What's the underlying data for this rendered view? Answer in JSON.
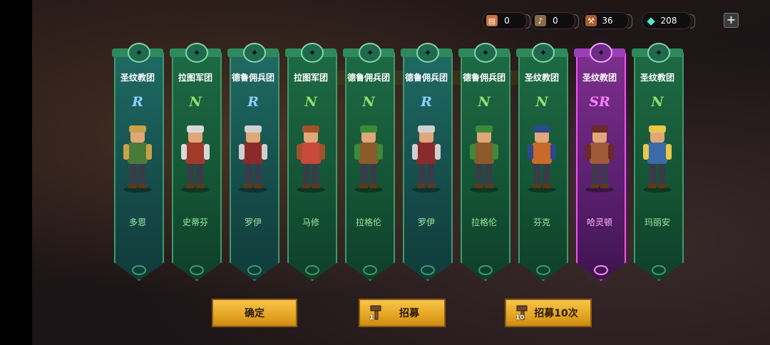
{
  "resources": [
    {
      "icon": "scroll-icon",
      "value": "0"
    },
    {
      "icon": "horn-icon",
      "value": "0"
    },
    {
      "icon": "hammer-icon",
      "value": "36"
    },
    {
      "icon": "diamond-icon",
      "value": "208"
    }
  ],
  "add_button_label": "+",
  "cards": [
    {
      "faction": "圣纹教团",
      "rarity": "R",
      "name": "多恩"
    },
    {
      "faction": "拉图军团",
      "rarity": "N",
      "name": "史蒂芬"
    },
    {
      "faction": "德鲁佣兵团",
      "rarity": "R",
      "name": "罗伊"
    },
    {
      "faction": "拉图军团",
      "rarity": "N",
      "name": "马修"
    },
    {
      "faction": "德鲁佣兵团",
      "rarity": "N",
      "name": "拉格伦"
    },
    {
      "faction": "德鲁佣兵团",
      "rarity": "R",
      "name": "罗伊"
    },
    {
      "faction": "德鲁佣兵团",
      "rarity": "N",
      "name": "拉格伦"
    },
    {
      "faction": "圣纹教团",
      "rarity": "N",
      "name": "芬克"
    },
    {
      "faction": "圣纹教团",
      "rarity": "SR",
      "name": "哈灵顿"
    },
    {
      "faction": "圣纹教团",
      "rarity": "N",
      "name": "玛丽安"
    }
  ],
  "buttons": {
    "confirm": "确定",
    "recruit_one": "招募",
    "recruit_one_count": "1",
    "recruit_ten": "招募10次",
    "recruit_ten_count": "10"
  },
  "colors": {
    "rarity_R": "#8fd0ff",
    "rarity_N": "#8ce070",
    "rarity_SR": "#ff7cff",
    "name_text": "#9be8a0",
    "button_gold": "#e4a522"
  }
}
